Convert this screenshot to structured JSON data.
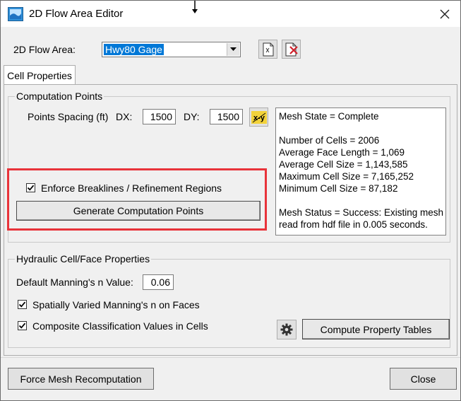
{
  "window": {
    "title": "2D Flow Area Editor"
  },
  "flow_area": {
    "label": "2D Flow Area:",
    "selected": "Hwy80 Gage"
  },
  "tabs": [
    {
      "label": "Cell Properties"
    }
  ],
  "computation_points": {
    "group_title": "Computation Points",
    "spacing_label": "Points Spacing (ft)",
    "dx_label": "DX:",
    "dx_value": "1500",
    "dy_label": "DY:",
    "dy_value": "1500",
    "enforce_label": "Enforce Breaklines / Refinement Regions",
    "enforce_checked": true,
    "generate_label": "Generate Computation Points"
  },
  "mesh_status": {
    "lines": [
      "Mesh State = Complete",
      "",
      "Number of Cells = 2006",
      "Average Face Length = 1,069",
      "Average Cell Size = 1,143,585",
      "Maximum Cell Size = 7,165,252",
      "Minimum Cell Size = 87,182",
      "",
      "Mesh Status = Success: Existing mesh",
      "read from hdf file in 0.005 seconds."
    ]
  },
  "hydraulic": {
    "group_title": "Hydraulic Cell/Face Properties",
    "mannings_label": "Default Manning's n Value:",
    "mannings_value": "0.06",
    "spatial_label": "Spatially Varied Manning's n on Faces",
    "spatial_checked": true,
    "composite_label": "Composite Classification Values in Cells",
    "composite_checked": true,
    "compute_label": "Compute Property Tables"
  },
  "footer": {
    "force_label": "Force Mesh Recomputation",
    "close_label": "Close"
  },
  "colors": {
    "highlight": "#e8333a",
    "selection": "#0078d7"
  }
}
